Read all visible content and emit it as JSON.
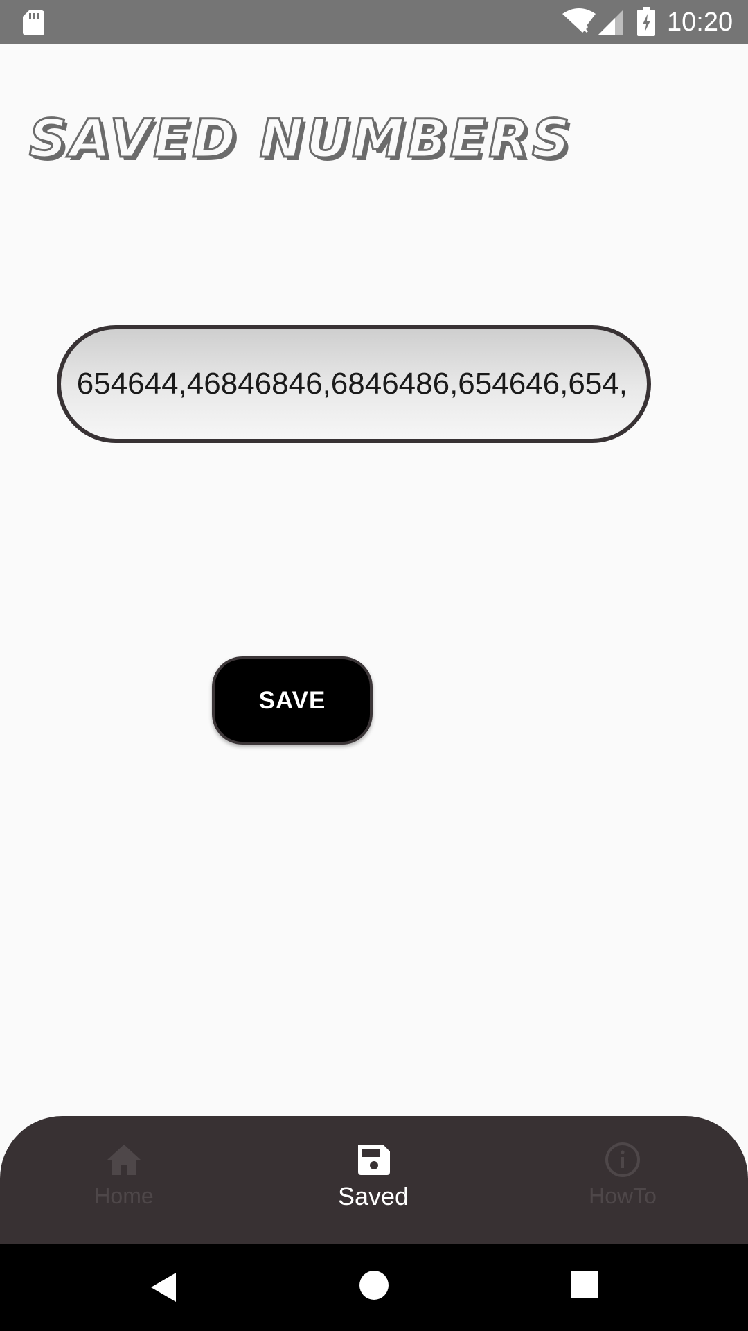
{
  "status_bar": {
    "time": "10:20",
    "icons": [
      "sd-card-icon",
      "wifi-icon",
      "signal-icon",
      "battery-charging-icon"
    ]
  },
  "page": {
    "title": "SAVED NUMBERS"
  },
  "numbers_field": {
    "value": "654644,46846846,6846486,654646,654,"
  },
  "actions": {
    "save_label": "SAVE"
  },
  "bottom_nav": {
    "items": [
      {
        "label": "Home",
        "icon": "home-icon",
        "active": false
      },
      {
        "label": "Saved",
        "icon": "save-icon",
        "active": true
      },
      {
        "label": "HowTo",
        "icon": "info-icon",
        "active": false
      }
    ]
  },
  "system_nav": {
    "icons": [
      "back-icon",
      "home-circle-icon",
      "recents-icon"
    ]
  },
  "colors": {
    "status_bar": "#757575",
    "background": "#fafafa",
    "nav_background": "#383133",
    "nav_inactive": "#4e4749",
    "nav_active": "#ffffff",
    "button_background": "#000000"
  }
}
